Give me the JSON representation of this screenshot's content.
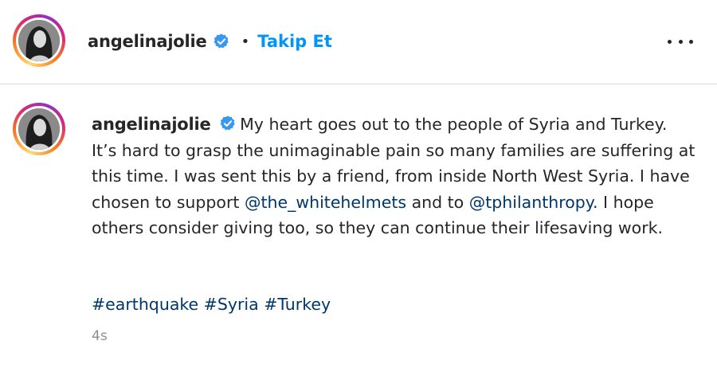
{
  "header": {
    "username": "angelinajolie",
    "separator": "•",
    "follow_label": "Takip Et"
  },
  "post": {
    "username": "angelinajolie",
    "caption_part1": "My heart goes out to the people of Syria and Turkey. It’s hard to grasp the unimaginable pain so many families are suffering at this time. I was sent this by a friend, from inside North West Syria. I have chosen to support ",
    "mention1": "@the_whitehelmets",
    "caption_part2": " and to ",
    "mention2": "@tphilanthropy",
    "caption_part3": ". I hope others consider giving too, so they can continue their lifesaving work.",
    "hashtags": [
      "#earthquake",
      "#Syria",
      "#Turkey"
    ],
    "timestamp": "4s"
  },
  "icons": {
    "verified": "verified-badge-icon",
    "more": "more-options-icon"
  },
  "colors": {
    "link_blue": "#0095f6",
    "mention_blue": "#00376b",
    "verified_blue": "#3897f0",
    "muted": "#8e8e8e"
  }
}
